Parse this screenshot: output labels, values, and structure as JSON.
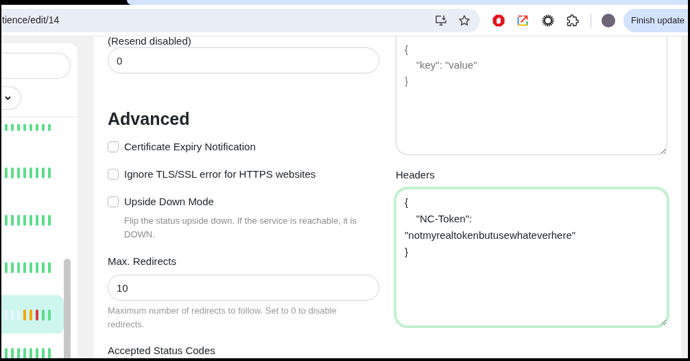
{
  "browser": {
    "address": "tience/edit/14",
    "update_button": "Finish update"
  },
  "sidebar": {
    "monitors": [
      {
        "selected": false,
        "beats": [
          {
            "color": "#5cdd8b"
          },
          {
            "color": "#5cdd8b"
          },
          {
            "color": "#5cdd8b"
          },
          {
            "color": "#5cdd8b"
          },
          {
            "color": "#5cdd8b"
          },
          {
            "color": "#5cdd8b"
          },
          {
            "color": "#5cdd8b"
          },
          {
            "color": "#5cdd8b"
          }
        ]
      },
      {
        "selected": false,
        "beats": [
          {
            "color": "#5cdd8b"
          },
          {
            "color": "#5cdd8b"
          },
          {
            "color": "#5cdd8b"
          },
          {
            "color": "#5cdd8b"
          },
          {
            "color": "#5cdd8b"
          },
          {
            "color": "#5cdd8b"
          },
          {
            "color": "#5cdd8b"
          },
          {
            "color": "#5cdd8b"
          }
        ]
      },
      {
        "selected": false,
        "beats": [
          {
            "color": "#5cdd8b"
          },
          {
            "color": "#5cdd8b"
          },
          {
            "color": "#5cdd8b"
          },
          {
            "color": "#5cdd8b"
          },
          {
            "color": "#5cdd8b"
          },
          {
            "color": "#5cdd8b"
          },
          {
            "color": "#5cdd8b"
          },
          {
            "color": "#5cdd8b"
          }
        ]
      },
      {
        "selected": false,
        "beats": [
          {
            "color": "#5cdd8b"
          },
          {
            "color": "#5cdd8b"
          },
          {
            "color": "#5cdd8b"
          },
          {
            "color": "#5cdd8b"
          },
          {
            "color": "#5cdd8b"
          },
          {
            "color": "#5cdd8b"
          },
          {
            "color": "#5cdd8b"
          },
          {
            "color": "#5cdd8b"
          }
        ]
      },
      {
        "selected": true,
        "beats": [
          {
            "color": "#e8f4f8"
          },
          {
            "color": "#e8f4f8"
          },
          {
            "color": "#e8f4f8"
          },
          {
            "color": "#f8a306"
          },
          {
            "color": "#f8a306"
          },
          {
            "color": "#dc3545"
          },
          {
            "color": "#5cdd8b"
          },
          {
            "color": "#5cdd8b"
          }
        ]
      },
      {
        "selected": false,
        "beats": [
          {
            "color": "#5cdd8b"
          },
          {
            "color": "#5cdd8b"
          },
          {
            "color": "#5cdd8b"
          },
          {
            "color": "#5cdd8b"
          },
          {
            "color": "#5cdd8b"
          },
          {
            "color": "#5cdd8b"
          },
          {
            "color": "#5cdd8b"
          },
          {
            "color": "#5cdd8b"
          }
        ]
      }
    ]
  },
  "form": {
    "resend": {
      "label": "(Resend disabled)",
      "value": "0"
    },
    "advanced": {
      "heading": "Advanced",
      "options": [
        {
          "label": "Certificate Expiry Notification",
          "checked": false
        },
        {
          "label": "Ignore TLS/SSL error for HTTPS websites",
          "checked": false
        },
        {
          "label": "Upside Down Mode",
          "checked": false,
          "description": "Flip the status upside down. If the service is reachable, it is DOWN."
        }
      ]
    },
    "max_redirects": {
      "label": "Max. Redirects",
      "value": "10",
      "help": "Maximum number of redirects to follow. Set to 0 to disable redirects."
    },
    "accepted_status_codes": {
      "label": "Accepted Status Codes"
    },
    "body": {
      "placeholder": "{\n    \"key\": \"value\"\n}"
    },
    "headers": {
      "label": "Headers",
      "value": "{\n    \"NC-Token\": \"notmyrealtokenbutusewhateverhere\"\n}",
      "focused": true
    }
  }
}
